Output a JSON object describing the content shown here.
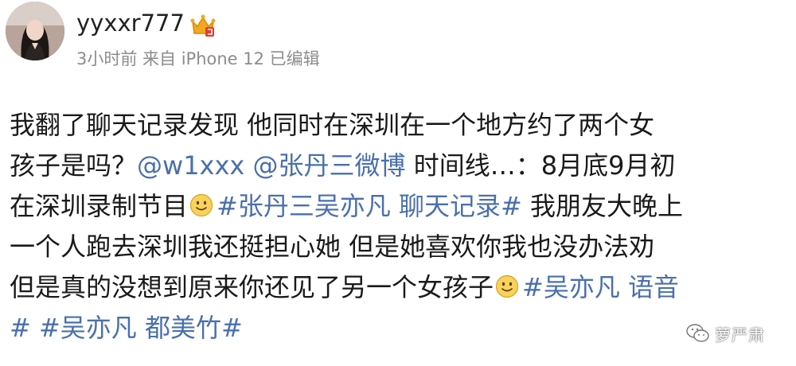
{
  "user": {
    "name": "yyxxr777",
    "badge_icon": "crown-badge-icon"
  },
  "meta": {
    "text": "3小时前 来自 iPhone 12 已编辑"
  },
  "post": {
    "line1": "我翻了聊天记录发现 他同时在深圳在一个地方约了两个女",
    "line2_a": "孩子是吗？",
    "mention1": "@w1xxx",
    "mention2": "@张丹三微博",
    "line2_b": " 时间线…：8月底9月初",
    "line3_a": "在深圳录制节目",
    "topic1": "#张丹三吴亦凡 聊天记录#",
    "line3_b": " 我朋友大晚上",
    "line4": "一个人跑去深圳我还挺担心她 但是她喜欢你我也没办法劝",
    "line5_a": "但是真的没想到原来你还见了另一个女孩子",
    "topic2": "#吴亦凡 语音",
    "topic2_end": "#",
    "topic3": "#吴亦凡 都美竹#"
  },
  "watermark": {
    "text": "萝严肃",
    "icon": "wechat-icon"
  },
  "colors": {
    "link": "#4a6fae",
    "text": "#1a1a1a",
    "meta": "#8c8c8c"
  }
}
